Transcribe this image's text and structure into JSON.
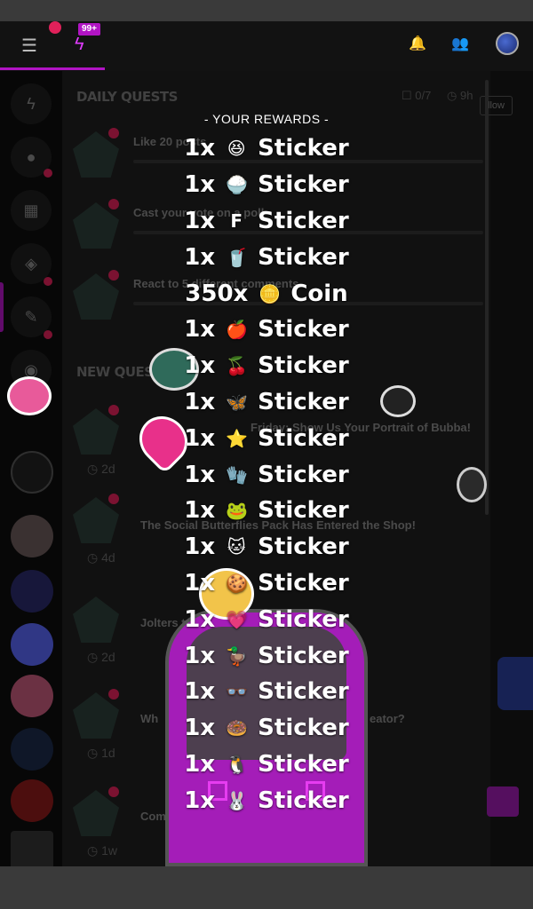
{
  "topbar": {
    "menu_icon": "hamburger-icon",
    "notification_badge": "99+",
    "bolt_icon": "lightning-icon",
    "bell_icon": "bell-icon",
    "people_icon": "people-icon"
  },
  "sidebar": {
    "icons": [
      "lightning-icon",
      "profile-icon",
      "shop-icon",
      "backpack-icon",
      "quest-icon",
      "chat-icon"
    ]
  },
  "daily_quests": {
    "title": "DAILY QUESTS",
    "count": "0/7",
    "time": "9h",
    "items": [
      {
        "label": "Like 20 posts"
      },
      {
        "label": "Cast your vote on a poll"
      },
      {
        "label": "React to 5 different comments"
      }
    ]
  },
  "new_quests": {
    "title": "NEW QUESTS",
    "items": [
      {
        "label": "Friday: Show Us Your Portrait of Bubba!",
        "age": "2d"
      },
      {
        "label": "The Social Butterflies Pack Has Entered the Shop!",
        "age": "4d"
      },
      {
        "label": "Jolters to",
        "age": "2d"
      },
      {
        "label": "Wh",
        "label_end": "eator?",
        "age": "1d"
      },
      {
        "label": "Com",
        "age": "1w"
      }
    ]
  },
  "right": {
    "follow_label": "llow"
  },
  "rewards": {
    "title": "- YOUR REWARDS -",
    "items": [
      {
        "qty": "1x",
        "icon": "😆",
        "name": "Sticker"
      },
      {
        "qty": "1x",
        "icon": "🍚",
        "name": "Sticker"
      },
      {
        "qty": "1x",
        "icon": "F",
        "name": "Sticker"
      },
      {
        "qty": "1x",
        "icon": "🥤",
        "name": "Sticker"
      },
      {
        "qty": "350x",
        "icon": "🪙",
        "name": "Coin"
      },
      {
        "qty": "1x",
        "icon": "🍎",
        "name": "Sticker"
      },
      {
        "qty": "1x",
        "icon": "🍒",
        "name": "Sticker"
      },
      {
        "qty": "1x",
        "icon": "🦋",
        "name": "Sticker"
      },
      {
        "qty": "1x",
        "icon": "⭐",
        "name": "Sticker"
      },
      {
        "qty": "1x",
        "icon": "🧤",
        "name": "Sticker"
      },
      {
        "qty": "1x",
        "icon": "🐸",
        "name": "Sticker"
      },
      {
        "qty": "1x",
        "icon": "🐱",
        "name": "Sticker"
      },
      {
        "qty": "1x",
        "icon": "🍪",
        "name": "Sticker"
      },
      {
        "qty": "1x",
        "icon": "💗",
        "name": "Sticker"
      },
      {
        "qty": "1x",
        "icon": "🦆",
        "name": "Sticker"
      },
      {
        "qty": "1x",
        "icon": "👓",
        "name": "Sticker"
      },
      {
        "qty": "1x",
        "icon": "🍩",
        "name": "Sticker"
      },
      {
        "qty": "1x",
        "icon": "🐧",
        "name": "Sticker"
      },
      {
        "qty": "1x",
        "icon": "🐰",
        "name": "Sticker"
      }
    ]
  },
  "colors": {
    "accent": "#b114c4",
    "notify": "#e0215a",
    "background": "#1f1f1f"
  }
}
